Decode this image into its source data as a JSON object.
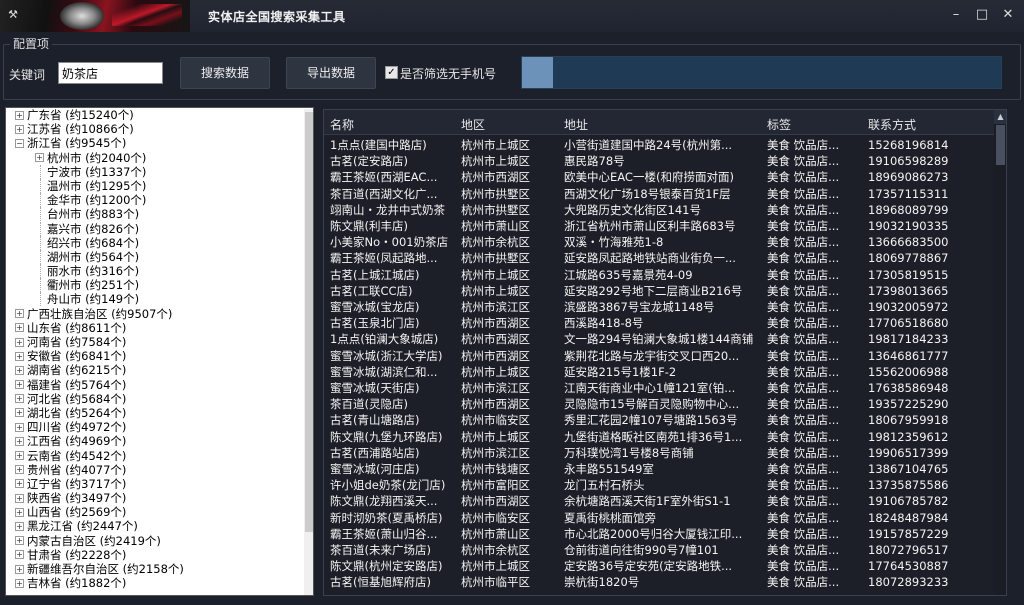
{
  "window": {
    "title": "实体店全国搜索采集工具",
    "controls": {
      "minimize": "–",
      "maximize": "□",
      "close": "✕"
    }
  },
  "config": {
    "group_title": "配置项",
    "keyword_label": "关键词",
    "keyword_value": "奶茶店",
    "search_button": "搜索数据",
    "export_button": "导出数据",
    "filter_checkbox_label": "是否筛选无手机号",
    "filter_checked": true,
    "progress": 0.065
  },
  "tree": {
    "items": [
      {
        "level": 0,
        "expander": "+",
        "label": "广东省 (约15240个)"
      },
      {
        "level": 0,
        "expander": "+",
        "label": "江苏省 (约10866个)"
      },
      {
        "level": 0,
        "expander": "−",
        "label": "浙江省 (约9545个)"
      },
      {
        "level": 1,
        "expander": "+",
        "label": "杭州市 (约2040个)"
      },
      {
        "level": 1,
        "expander": "",
        "label": "宁波市 (约1337个)"
      },
      {
        "level": 1,
        "expander": "",
        "label": "温州市 (约1295个)"
      },
      {
        "level": 1,
        "expander": "",
        "label": "金华市 (约1200个)"
      },
      {
        "level": 1,
        "expander": "",
        "label": "台州市 (约883个)"
      },
      {
        "level": 1,
        "expander": "",
        "label": "嘉兴市 (约826个)"
      },
      {
        "level": 1,
        "expander": "",
        "label": "绍兴市 (约684个)"
      },
      {
        "level": 1,
        "expander": "",
        "label": "湖州市 (约564个)"
      },
      {
        "level": 1,
        "expander": "",
        "label": "丽水市 (约316个)"
      },
      {
        "level": 1,
        "expander": "",
        "label": "衢州市 (约251个)"
      },
      {
        "level": 1,
        "expander": "",
        "label": "舟山市 (约149个)"
      },
      {
        "level": 0,
        "expander": "+",
        "label": "广西壮族自治区 (约9507个)"
      },
      {
        "level": 0,
        "expander": "+",
        "label": "山东省 (约8611个)"
      },
      {
        "level": 0,
        "expander": "+",
        "label": "河南省 (约7584个)"
      },
      {
        "level": 0,
        "expander": "+",
        "label": "安徽省 (约6841个)"
      },
      {
        "level": 0,
        "expander": "+",
        "label": "湖南省 (约6215个)"
      },
      {
        "level": 0,
        "expander": "+",
        "label": "福建省 (约5764个)"
      },
      {
        "level": 0,
        "expander": "+",
        "label": "河北省 (约5684个)"
      },
      {
        "level": 0,
        "expander": "+",
        "label": "湖北省 (约5264个)"
      },
      {
        "level": 0,
        "expander": "+",
        "label": "四川省 (约4972个)"
      },
      {
        "level": 0,
        "expander": "+",
        "label": "江西省 (约4969个)"
      },
      {
        "level": 0,
        "expander": "+",
        "label": "云南省 (约4542个)"
      },
      {
        "level": 0,
        "expander": "+",
        "label": "贵州省 (约4077个)"
      },
      {
        "level": 0,
        "expander": "+",
        "label": "辽宁省 (约3717个)"
      },
      {
        "level": 0,
        "expander": "+",
        "label": "陕西省 (约3497个)"
      },
      {
        "level": 0,
        "expander": "+",
        "label": "山西省 (约2569个)"
      },
      {
        "level": 0,
        "expander": "+",
        "label": "黑龙江省 (约2447个)"
      },
      {
        "level": 0,
        "expander": "+",
        "label": "内蒙古自治区 (约2419个)"
      },
      {
        "level": 0,
        "expander": "+",
        "label": "甘肃省 (约2228个)"
      },
      {
        "level": 0,
        "expander": "+",
        "label": "新疆维吾尔自治区 (约2158个)"
      },
      {
        "level": 0,
        "expander": "+",
        "label": "吉林省 (约1882个)"
      }
    ]
  },
  "grid": {
    "headers": [
      "名称",
      "地区",
      "地址",
      "标签",
      "联系方式"
    ],
    "rows": [
      [
        "1点点(建国中路店)",
        "杭州市上城区",
        "小营街道建国中路24号(杭州第...",
        "美食 饮品店...",
        "15268196814"
      ],
      [
        "古茗(定安路店)",
        "杭州市上城区",
        "惠民路78号",
        "美食 饮品店...",
        "19106598289"
      ],
      [
        "霸王茶姬(西湖EAC...",
        "杭州市西湖区",
        "欧美中心EAC一楼(和府捞面对面)",
        "美食 饮品店...",
        "18969086273"
      ],
      [
        "茶百道(西湖文化广...",
        "杭州市拱墅区",
        "西湖文化广场18号银泰百货1F层",
        "美食 饮品店...",
        "17357115311"
      ],
      [
        "翊南山・龙井中式奶茶",
        "杭州市拱墅区",
        "大兜路历史文化街区141号",
        "美食 饮品店...",
        "18968089799"
      ],
      [
        "陈文鼎(利丰店)",
        "杭州市萧山区",
        "浙江省杭州市萧山区利丰路683号",
        "美食 饮品店...",
        "19032190335"
      ],
      [
        "小美家No・001奶茶店",
        "杭州市余杭区",
        "双溪・竹海雅苑1-8",
        "美食 饮品店...",
        "13666683500"
      ],
      [
        "霸王茶姬(凤起路地...",
        "杭州市拱墅区",
        "延安路凤起路地铁站商业街负一...",
        "美食 饮品店...",
        "18069778867"
      ],
      [
        "古茗(上城江城店)",
        "杭州市上城区",
        "江城路635号嘉景苑4-09",
        "美食 饮品店...",
        "17305819515"
      ],
      [
        "古茗(工联CC店)",
        "杭州市上城区",
        "延安路292号地下二层商业B216号",
        "美食 饮品店...",
        "17398013665"
      ],
      [
        "蜜雪冰城(宝龙店)",
        "杭州市滨江区",
        "滨盛路3867号宝龙城1148号",
        "美食 饮品店...",
        "19032005972"
      ],
      [
        "古茗(玉泉北门店)",
        "杭州市西湖区",
        "西溪路418-8号",
        "美食 饮品店...",
        "17706518680"
      ],
      [
        "1点点(铂澜大象城店)",
        "杭州市西湖区",
        "文一路294号铂澜大象城1楼144商铺",
        "美食 饮品店...",
        "19817184233"
      ],
      [
        "蜜雪冰城(浙江大学店)",
        "杭州市西湖区",
        "紫荆花北路与龙宇街交叉口西20...",
        "美食 饮品店...",
        "13646861777"
      ],
      [
        "蜜雪冰城(湖滨仁和...",
        "杭州市上城区",
        "延安路215号1楼1F-2",
        "美食 饮品店...",
        "15562006988"
      ],
      [
        "蜜雪冰城(天街店)",
        "杭州市滨江区",
        "江南天街商业中心1幢121室(铂...",
        "美食 饮品店...",
        "17638586948"
      ],
      [
        "茶百道(灵隐店)",
        "杭州市西湖区",
        "灵隐隐市15号解百灵隐购物中心...",
        "美食 饮品店...",
        "19357225290"
      ],
      [
        "古茗(青山塘路店)",
        "杭州市临安区",
        "秀里汇花园2幢107号塘路1563号",
        "美食 饮品店...",
        "18067959918"
      ],
      [
        "陈文鼎(九堡九环路店)",
        "杭州市上城区",
        "九堡街道格畈社区南苑1排36号1...",
        "美食 饮品店...",
        "19812359612"
      ],
      [
        "古茗(西浦路站店)",
        "杭州市滨江区",
        "万科璞悦湾1号楼8号商铺",
        "美食 饮品店...",
        "19906517399"
      ],
      [
        "蜜雪冰城(河庄店)",
        "杭州市钱塘区",
        "永丰路551549室",
        "美食 饮品店...",
        "13867104765"
      ],
      [
        "许小姐de奶茶(龙门店)",
        "杭州市富阳区",
        "龙门五村石桥头",
        "美食 饮品店...",
        "13735875586"
      ],
      [
        "陈文鼎(龙翔西溪天...",
        "杭州市西湖区",
        "余杭塘路西溪天街1F室外街S1-1",
        "美食 饮品店...",
        "19106785782"
      ],
      [
        "新时沏奶茶(夏禹桥店)",
        "杭州市临安区",
        "夏禹街桃桃面馆旁",
        "美食 饮品店...",
        "18248487984"
      ],
      [
        "霸王茶姬(萧山归谷...",
        "杭州市萧山区",
        "市心北路2000号归谷大厦钱江印...",
        "美食 饮品店...",
        "19157857229"
      ],
      [
        "茶百道(未来广场店)",
        "杭州市余杭区",
        "仓前街道向往街990号7幢101",
        "美食 饮品店...",
        "18072796517"
      ],
      [
        "陈文鼎(杭州定安路店)",
        "杭州市上城区",
        "定安路36号定安苑(定安路地铁...",
        "美食 饮品店...",
        "17764530887"
      ],
      [
        "古茗(恒基旭辉府店)",
        "杭州市临平区",
        "崇杭街1820号",
        "美食 饮品店...",
        "18072893233"
      ]
    ]
  }
}
